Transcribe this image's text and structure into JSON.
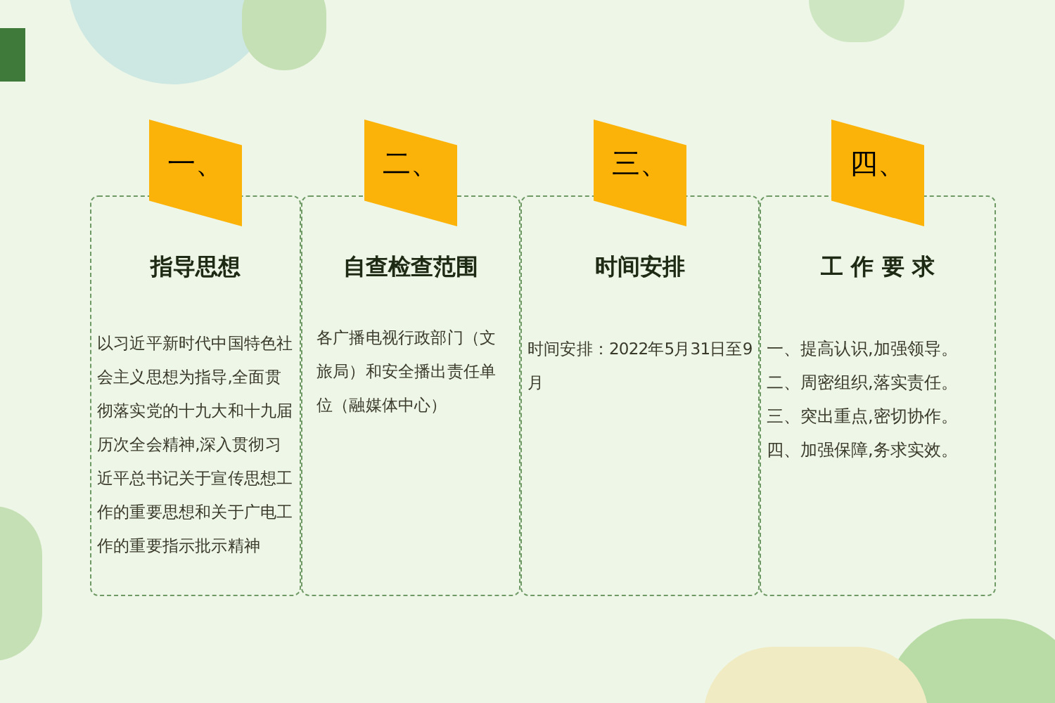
{
  "sections": [
    {
      "number": "一、",
      "title": "指导思想",
      "kind": "paragraph",
      "text": "以习近平新时代中国特色社会主义思想为指导,全面贯彻落实党的十九大和十九届历次全会精神,深入贯彻习近平总书记关于宣传思想工作的重要思想和关于广电工作的重要指示批示精神"
    },
    {
      "number": "二、",
      "title": "自查检查范围",
      "kind": "paragraph",
      "text": "各广播电视行政部门（文旅局）和安全播出责任单位（融媒体中心）"
    },
    {
      "number": "三、",
      "title": "时间安排",
      "kind": "paragraph",
      "text": "时间安排：2022年5月31日至9月"
    },
    {
      "number": "四、",
      "title": "工 作 要 求",
      "kind": "list",
      "items": [
        "一、提高认识,加强领导。",
        "二、周密组织,落实责任。",
        "三、突出重点,密切协作。",
        "四、加强保障,务求实效。"
      ]
    }
  ]
}
